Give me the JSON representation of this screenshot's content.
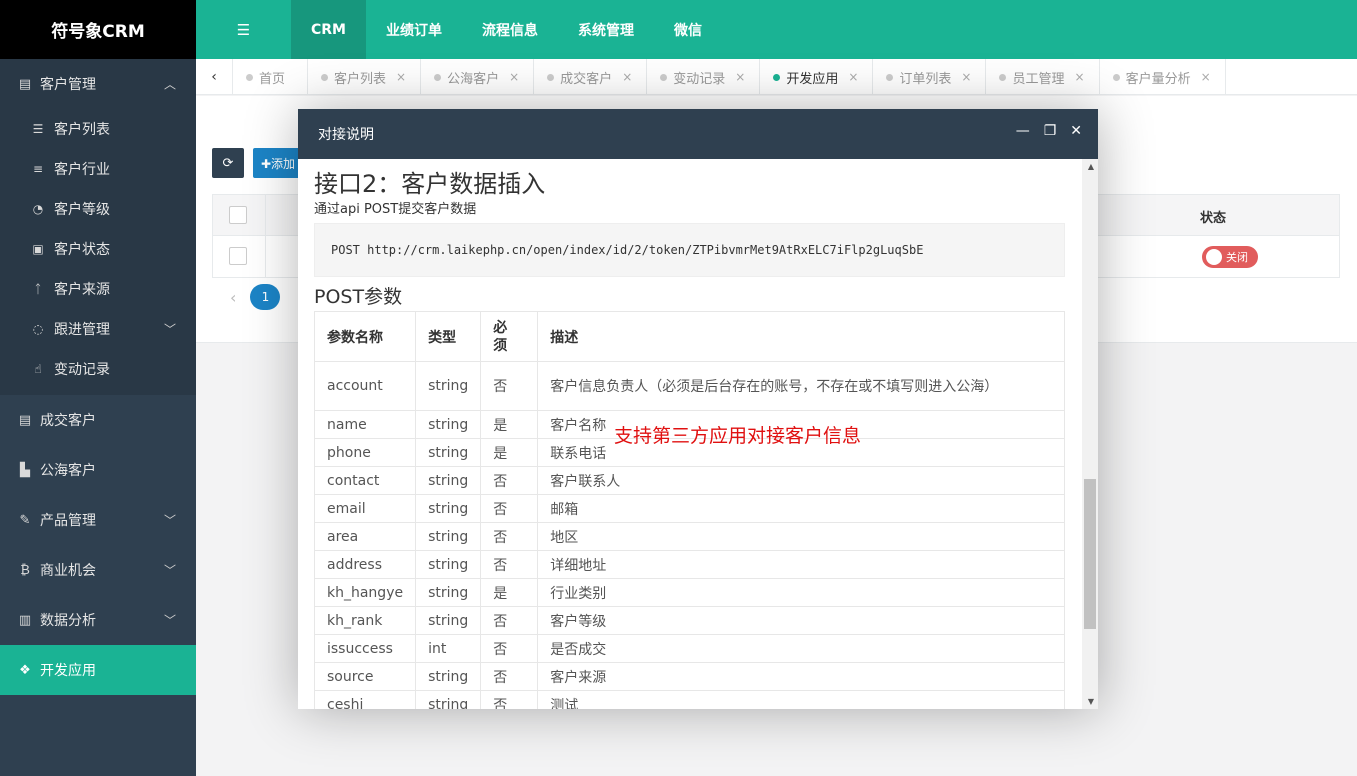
{
  "app": {
    "logo": "符号象CRM"
  },
  "topnav": {
    "toggle_icon": "menu-icon",
    "items": [
      "CRM",
      "业绩订单",
      "流程信息",
      "系统管理",
      "微信"
    ]
  },
  "sidebar": {
    "groups": [
      {
        "label": "客户管理",
        "icon": "id-card-icon",
        "expanded": true,
        "children": [
          {
            "label": "客户列表",
            "icon": "list-icon"
          },
          {
            "label": "客户行业",
            "icon": "align-center-icon"
          },
          {
            "label": "客户等级",
            "icon": "dashboard-icon"
          },
          {
            "label": "客户状态",
            "icon": "newspaper-icon"
          },
          {
            "label": "客户来源",
            "icon": "walking-icon"
          },
          {
            "label": "跟进管理",
            "icon": "comments-icon"
          },
          {
            "label": "变动记录",
            "icon": "hand-pointer-icon"
          }
        ]
      },
      {
        "label": "成交客户",
        "icon": "id-card-icon"
      },
      {
        "label": "公海客户",
        "icon": "area-chart-icon"
      },
      {
        "label": "产品管理",
        "icon": "paint-brush-icon"
      },
      {
        "label": "商业机会",
        "icon": "bitcoin-icon"
      },
      {
        "label": "数据分析",
        "icon": "bar-chart-icon"
      },
      {
        "label": "开发应用",
        "icon": "cubes-icon",
        "active": true
      }
    ]
  },
  "tabs": {
    "items": [
      {
        "label": "首页",
        "closable": false
      },
      {
        "label": "客户列表",
        "closable": true
      },
      {
        "label": "公海客户",
        "closable": true
      },
      {
        "label": "成交客户",
        "closable": true
      },
      {
        "label": "变动记录",
        "closable": true
      },
      {
        "label": "开发应用",
        "closable": true,
        "active": true
      },
      {
        "label": "订单列表",
        "closable": true
      },
      {
        "label": "员工管理",
        "closable": true
      },
      {
        "label": "客户量分析",
        "closable": true
      }
    ],
    "close_glyph": "×"
  },
  "background": {
    "add_label": "✚添加",
    "status_header": "状态",
    "status_value": "关闭",
    "page": "1"
  },
  "modal": {
    "title": "对接说明",
    "heading": "接口2：客户数据插入",
    "desc": "通过api POST提交客户数据",
    "code": "POST http://crm.laikephp.cn/open/index/id/2/token/ZTPibvmrMet9AtRxELC7iFlp2gLuqSbE",
    "params_title": "POST参数",
    "table": {
      "headers": [
        "参数名称",
        "类型",
        "必须",
        "描述"
      ],
      "rows": [
        [
          "account",
          "string",
          "否",
          "客户信息负责人（必须是后台存在的账号，不存在或不填写则进入公海）"
        ],
        [
          "name",
          "string",
          "是",
          "客户名称"
        ],
        [
          "phone",
          "string",
          "是",
          "联系电话"
        ],
        [
          "contact",
          "string",
          "否",
          "客户联系人"
        ],
        [
          "email",
          "string",
          "否",
          "邮箱"
        ],
        [
          "area",
          "string",
          "否",
          "地区"
        ],
        [
          "address",
          "string",
          "否",
          "详细地址"
        ],
        [
          "kh_hangye",
          "string",
          "是",
          "行业类别"
        ],
        [
          "kh_rank",
          "string",
          "否",
          "客户等级"
        ],
        [
          "issuccess",
          "int",
          "否",
          "是否成交"
        ],
        [
          "source",
          "string",
          "否",
          "客户来源"
        ],
        [
          "ceshi",
          "string",
          "否",
          "测试"
        ]
      ]
    }
  },
  "annotation": "支持第三方应用对接客户信息"
}
